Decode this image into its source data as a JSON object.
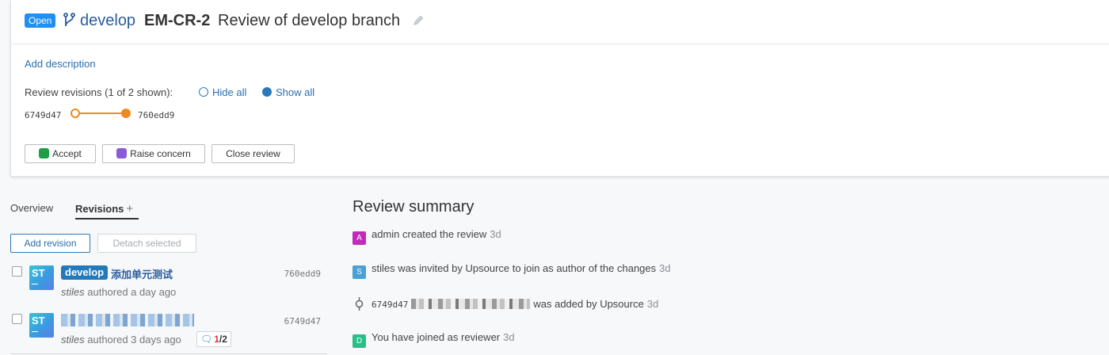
{
  "header": {
    "status": "Open",
    "branch": "develop",
    "review_id": "EM-CR-2",
    "title": "Review of develop branch"
  },
  "description_link": "Add description",
  "revisions_filter": {
    "label": "Review revisions (1 of 2 shown):",
    "hide_all": "Hide all",
    "show_all": "Show all",
    "selected": "Show all"
  },
  "range": {
    "from": "6749d47",
    "to": "760edd9"
  },
  "actions": {
    "accept": "Accept",
    "raise_concern": "Raise concern",
    "close_review": "Close review"
  },
  "tabs": {
    "overview": "Overview",
    "revisions": "Revisions",
    "active": "Revisions"
  },
  "revision_buttons": {
    "add": "Add revision",
    "detach": "Detach selected"
  },
  "revisions": [
    {
      "avatar": "ST",
      "branch": "develop",
      "message": "添加单元测试",
      "hash": "760edd9",
      "author": "stiles",
      "authored": "authored a day ago"
    },
    {
      "avatar": "ST",
      "hash": "6749d47",
      "author": "stiles",
      "authored": "authored 3 days ago",
      "comments": {
        "unread": "1",
        "total": "/2"
      }
    }
  ],
  "summary": {
    "title": "Review summary",
    "events": [
      {
        "avatar": "A",
        "text": "admin created the review",
        "time": "3d"
      },
      {
        "avatar": "S",
        "text": "stiles was invited by Upsource to join as author of the changes",
        "time": "3d"
      },
      {
        "hash": "6749d47",
        "text": "was added by Upsource",
        "time": "3d"
      },
      {
        "avatar": "D",
        "text": "You have joined as reviewer",
        "time": "3d"
      }
    ]
  },
  "colors": {
    "accent": "#1f8ff2",
    "link": "#2a6fb0",
    "range": "#f08a18",
    "branch_tag": "#2479b8"
  }
}
